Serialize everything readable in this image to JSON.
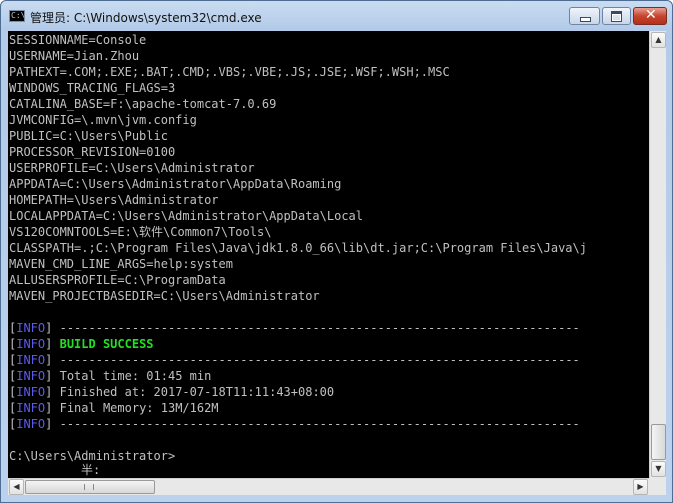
{
  "window": {
    "title": "管理员: C:\\Windows\\system32\\cmd.exe",
    "app_icon_text": "C:\\",
    "controls": {
      "minimize_icon": "minimize-icon",
      "maximize_icon": "maximize-icon",
      "close_icon": "close-icon",
      "close_glyph": "✕"
    }
  },
  "console": {
    "env_lines": [
      "SESSIONNAME=Console",
      "USERNAME=Jian.Zhou",
      "PATHEXT=.COM;.EXE;.BAT;.CMD;.VBS;.VBE;.JS;.JSE;.WSF;.WSH;.MSC",
      "WINDOWS_TRACING_FLAGS=3",
      "CATALINA_BASE=F:\\apache-tomcat-7.0.69",
      "JVMCONFIG=\\.mvn\\jvm.config",
      "PUBLIC=C:\\Users\\Public",
      "PROCESSOR_REVISION=0100",
      "USERPROFILE=C:\\Users\\Administrator",
      "APPDATA=C:\\Users\\Administrator\\AppData\\Roaming",
      "HOMEPATH=\\Users\\Administrator",
      "LOCALAPPDATA=C:\\Users\\Administrator\\AppData\\Local",
      "VS120COMNTOOLS=E:\\软件\\Common7\\Tools\\",
      "CLASSPATH=.;C:\\Program Files\\Java\\jdk1.8.0_66\\lib\\dt.jar;C:\\Program Files\\Java\\j",
      "MAVEN_CMD_LINE_ARGS=help:system",
      "ALLUSERSPROFILE=C:\\ProgramData",
      "MAVEN_PROJECTBASEDIR=C:\\Users\\Administrator"
    ],
    "info_lines": [
      {
        "tag": "INFO",
        "text": "------------------------------------------------------------------------",
        "style": "plain"
      },
      {
        "tag": "INFO",
        "text": "BUILD SUCCESS",
        "style": "success"
      },
      {
        "tag": "INFO",
        "text": "------------------------------------------------------------------------",
        "style": "plain"
      },
      {
        "tag": "INFO",
        "text": "Total time: 01:45 min",
        "style": "plain"
      },
      {
        "tag": "INFO",
        "text": "Finished at: 2017-07-18T11:11:43+08:00",
        "style": "plain"
      },
      {
        "tag": "INFO",
        "text": "Final Memory: 13M/162M",
        "style": "plain"
      },
      {
        "tag": "INFO",
        "text": "------------------------------------------------------------------------",
        "style": "plain"
      }
    ],
    "prompt": "C:\\Users\\Administrator>",
    "ime_text": "半:"
  },
  "scrollbars": {
    "up_arrow": "▲",
    "down_arrow": "▼",
    "left_arrow": "◀",
    "right_arrow": "▶"
  },
  "colors": {
    "console_bg": "#000000",
    "console_text": "#c0c0c0",
    "info_tag": "#5a5af0",
    "success": "#22e022"
  }
}
